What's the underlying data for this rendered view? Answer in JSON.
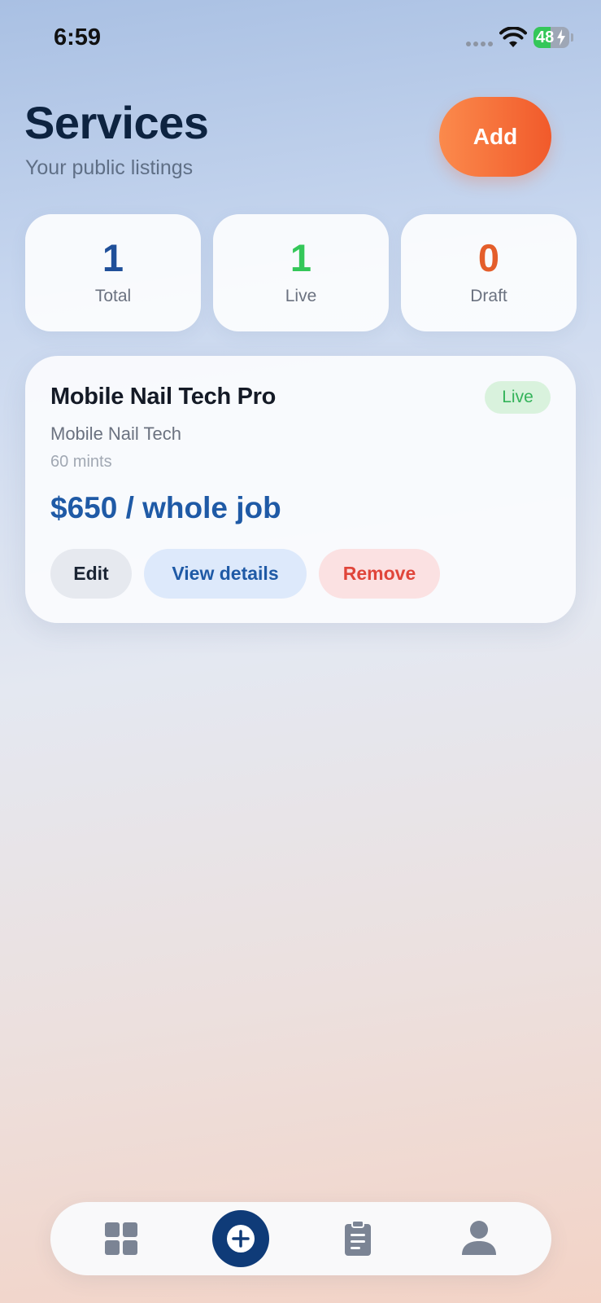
{
  "status_bar": {
    "time": "6:59",
    "battery_level": "48",
    "battery_percent": 48
  },
  "header": {
    "title": "Services",
    "subtitle": "Your public listings",
    "add_label": "Add"
  },
  "stats": [
    {
      "value": "1",
      "label": "Total",
      "color": "#1f4f99"
    },
    {
      "value": "1",
      "label": "Live",
      "color": "#34c759"
    },
    {
      "value": "0",
      "label": "Draft",
      "color": "#e45e2b"
    }
  ],
  "services": [
    {
      "name": "Mobile Nail Tech Pro",
      "status": "Live",
      "category": "Mobile Nail Tech",
      "duration": "60 mints",
      "price": "$650 / whole job",
      "actions": {
        "edit": "Edit",
        "view": "View details",
        "remove": "Remove"
      }
    }
  ],
  "bottom_nav": {
    "items": [
      {
        "icon": "grid-icon"
      },
      {
        "icon": "plus-circle-icon"
      },
      {
        "icon": "clipboard-icon"
      },
      {
        "icon": "person-icon"
      }
    ]
  },
  "colors": {
    "brand_dark": "#0f3b78",
    "accent_orange": "#f15a2b",
    "live_green": "#34c759",
    "price_blue": "#1f5aa6"
  }
}
